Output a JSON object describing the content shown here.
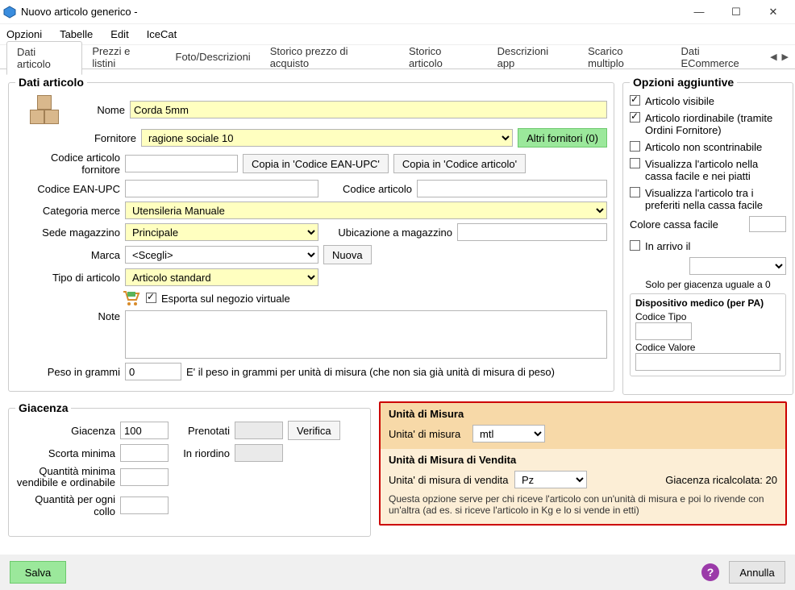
{
  "window": {
    "title": "Nuovo articolo generico -"
  },
  "menu": {
    "opzioni": "Opzioni",
    "tabelle": "Tabelle",
    "edit": "Edit",
    "icecat": "IceCat"
  },
  "tabs": {
    "dati_articolo": "Dati articolo",
    "prezzi": "Prezzi e listini",
    "foto": "Foto/Descrizioni",
    "storico_acq": "Storico prezzo di acquisto",
    "storico_art": "Storico articolo",
    "desc_app": "Descrizioni app",
    "scarico": "Scarico multiplo",
    "ecommerce": "Dati ECommerce"
  },
  "dati": {
    "legend": "Dati articolo",
    "nome_label": "Nome",
    "nome_value": "Corda 5mm",
    "fornitore_label": "Fornitore",
    "fornitore_value": "ragione sociale 10",
    "altri_fornitori": "Altri fornitori (0)",
    "cod_art_forn_label": "Codice articolo fornitore",
    "cod_art_forn_value": "",
    "copia_ean": "Copia in 'Codice EAN-UPC'",
    "copia_art": "Copia in 'Codice articolo'",
    "ean_label": "Codice EAN-UPC",
    "ean_value": "",
    "codart_label": "Codice articolo",
    "codart_value": "",
    "categoria_label": "Categoria merce",
    "categoria_value": "Utensileria Manuale",
    "sede_label": "Sede magazzino",
    "sede_value": "Principale",
    "ubicazione_label": "Ubicazione a magazzino",
    "ubicazione_value": "",
    "marca_label": "Marca",
    "marca_value": "<Scegli>",
    "nuova": "Nuova",
    "tipo_label": "Tipo di articolo",
    "tipo_value": "Articolo standard",
    "esporta": "Esporta sul negozio virtuale",
    "note_label": "Note",
    "note_value": "",
    "peso_label": "Peso in grammi",
    "peso_value": "0",
    "peso_hint": "E' il peso in grammi per unità di misura (che non sia già unità di misura di peso)"
  },
  "side": {
    "legend": "Opzioni aggiuntive",
    "visibile": "Articolo visibile",
    "riordinabile": "Articolo riordinabile (tramite Ordini Fornitore)",
    "non_scontr": "Articolo non scontrinabile",
    "cassa_facile": "Visualizza l'articolo nella cassa facile e nei piatti",
    "preferiti": "Visualizza l'articolo tra i preferiti nella cassa facile",
    "colore_label": "Colore cassa facile",
    "in_arrivo": "In arrivo il",
    "in_arrivo_value": "",
    "solo_giac": "Solo per giacenza uguale a 0",
    "med_legend": "Dispositivo medico (per PA)",
    "cod_tipo": "Codice Tipo",
    "cod_tipo_val": "",
    "cod_valore": "Codice Valore",
    "cod_valore_val": ""
  },
  "giacenza": {
    "legend": "Giacenza",
    "giac_label": "Giacenza",
    "giac_value": "100",
    "prenotati_label": "Prenotati",
    "prenotati_value": "",
    "verifica": "Verifica",
    "scorta_label": "Scorta minima",
    "scorta_value": "",
    "riordino_label": "In riordino",
    "riordino_value": "",
    "qmin_label": "Quantità minima vendibile e ordinabile",
    "qmin_value": "",
    "qcollo_label": "Quantità per ogni collo",
    "qcollo_value": ""
  },
  "um": {
    "legend1": "Unità di Misura",
    "label1": "Unita' di misura",
    "value1": "mtl",
    "legend2": "Unità di Misura di Vendita",
    "label2": "Unita' di misura di vendita",
    "value2": "Pz",
    "giac_ricalc": "Giacenza ricalcolata: 20",
    "note": "Questa opzione serve per chi riceve l'articolo con un'unità di misura e poi lo rivende con un'altra (ad es. si riceve l'articolo in Kg e lo si vende in etti)"
  },
  "footer": {
    "salva": "Salva",
    "annulla": "Annulla"
  }
}
